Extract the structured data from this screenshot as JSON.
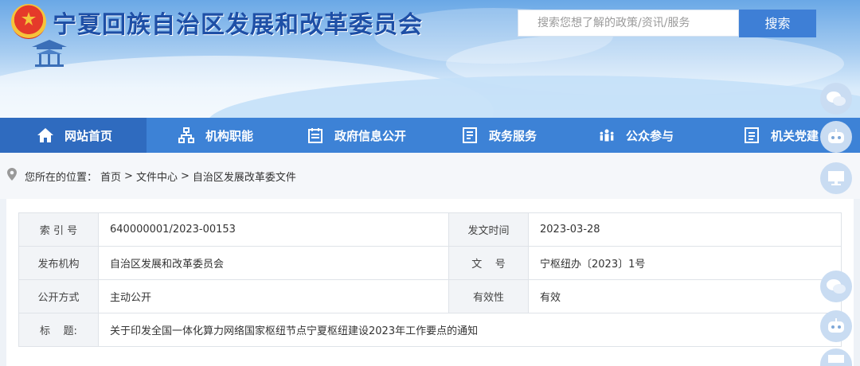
{
  "header": {
    "site_title": "宁夏回族自治区发展和改革委员会",
    "search_placeholder": "搜索您想了解的政策/资讯/服务",
    "search_button": "搜索"
  },
  "nav": {
    "items": [
      {
        "label": "网站首页",
        "icon": "home-icon"
      },
      {
        "label": "机构职能",
        "icon": "org-chart-icon"
      },
      {
        "label": "政府信息公开",
        "icon": "calendar-doc-icon"
      },
      {
        "label": "政务服务",
        "icon": "list-doc-icon"
      },
      {
        "label": "公众参与",
        "icon": "people-icon"
      },
      {
        "label": "机关党建",
        "icon": "doc-icon"
      }
    ]
  },
  "breadcrumb": {
    "prefix": "您所在的位置：",
    "items": [
      "首页",
      "文件中心",
      "自治区发展改革委文件"
    ],
    "separator": ">"
  },
  "doc_info": {
    "index_label": "索 引 号",
    "index_value": "640000001/2023-00153",
    "date_label": "发文时间",
    "date_value": "2023-03-28",
    "publisher_label": "发布机构",
    "publisher_value": "自治区发展和改革委员会",
    "docno_label": "文    号",
    "docno_value": "宁枢纽办〔2023〕1号",
    "mode_label": "公开方式",
    "mode_value": "主动公开",
    "validity_label": "有效性",
    "validity_value": "有效",
    "title_label": "标    题:",
    "title_value": "关于印发全国一体化算力网络国家枢纽节点宁夏枢纽建设2023年工作要点的通知"
  },
  "side_floats": [
    "wechat-icon",
    "robot-icon",
    "monitor-icon",
    "wechat-icon",
    "robot-icon",
    "monitor-icon"
  ],
  "colors": {
    "nav_bg": "#3d82d6",
    "nav_active": "#2f6bbf",
    "title_blue": "#1e4fa6",
    "search_button": "#3e7fd6"
  }
}
